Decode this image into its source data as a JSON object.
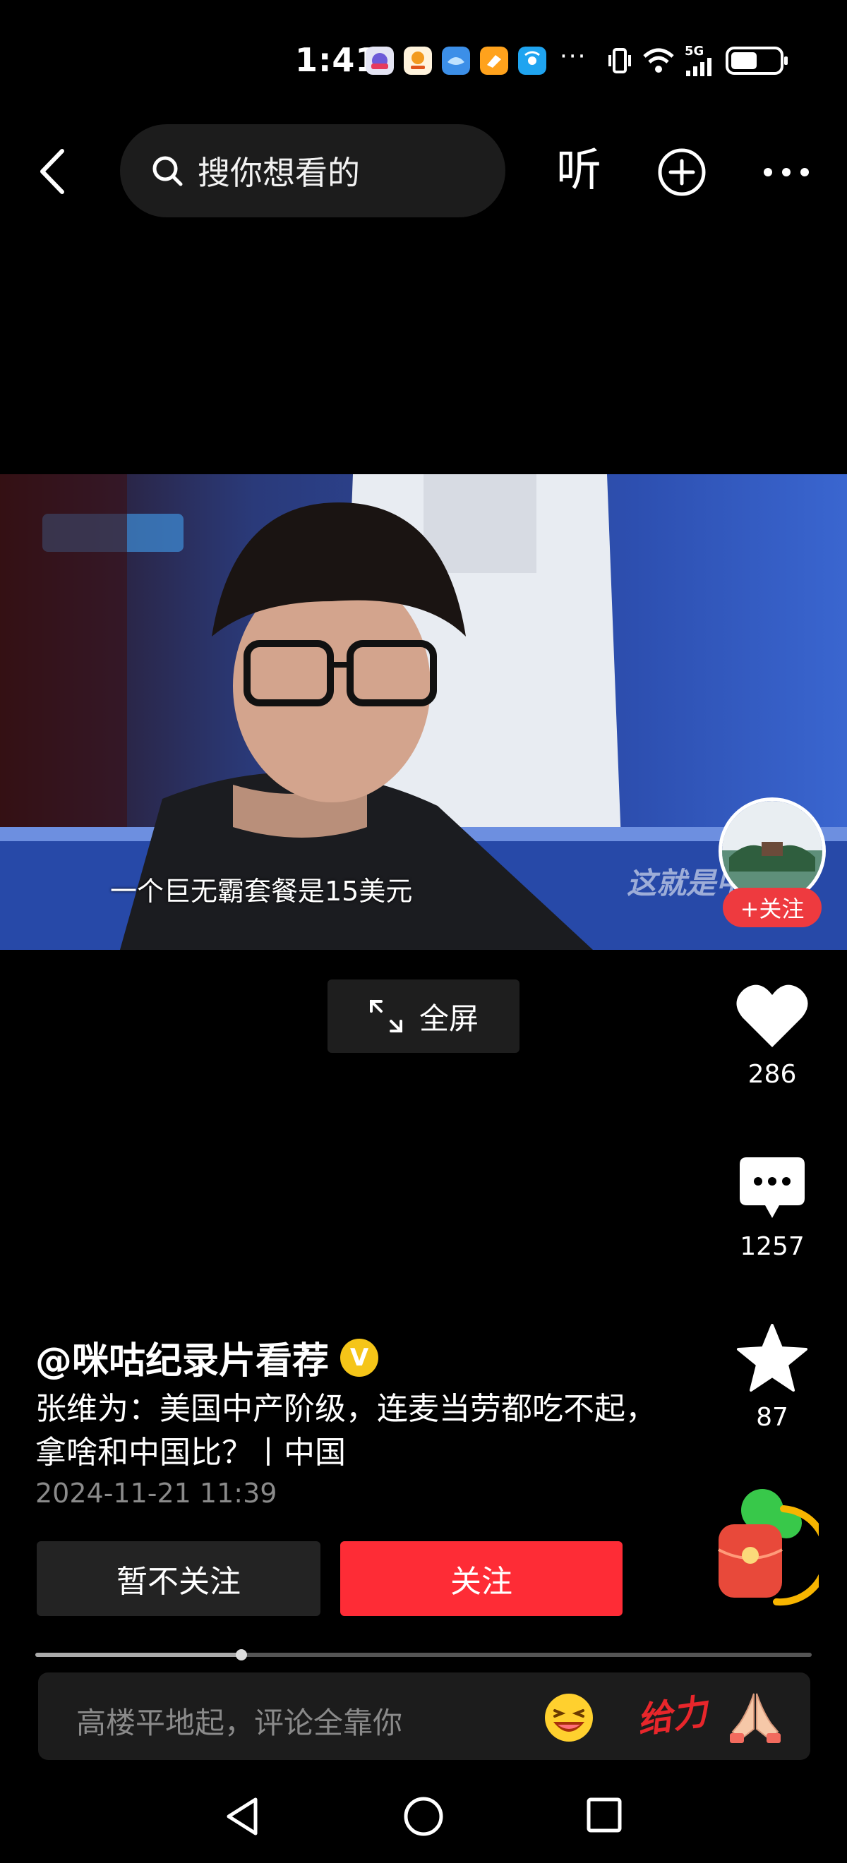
{
  "status_bar": {
    "time": "1:41",
    "more": "···",
    "network": "5G",
    "battery_level": 0.55,
    "icons": [
      "app-icon",
      "app-icon",
      "app-icon",
      "app-icon",
      "app-icon",
      "vibrate-icon",
      "wifi-icon",
      "signal-icon",
      "battery-icon"
    ]
  },
  "top_bar": {
    "search_placeholder": "搜你想看的",
    "listen_label": "听",
    "icons": [
      "back-icon",
      "search-icon",
      "add-icon",
      "more-icon"
    ]
  },
  "video": {
    "subtitle": "一个巨无霸套餐是15美元",
    "watermark": "这就是中",
    "follow_chip": "+关注",
    "fullscreen_label": "全屏"
  },
  "actions": {
    "likes": "286",
    "comments": "1257",
    "favorites": "87"
  },
  "post": {
    "author": "@咪咕纪录片看荐",
    "verified_mark": "V",
    "caption": "张维为：美国中产阶级，连麦当劳都吃不起，拿啥和中国比？丨中国",
    "time": "2024-11-21 11:39"
  },
  "buttons": {
    "dismiss": "暂不关注",
    "follow": "关注"
  },
  "progress": 0.265,
  "comment_bar": {
    "placeholder": "高楼平地起，评论全靠你",
    "sticker_text": "给力"
  },
  "colors": {
    "accent_red": "#fe2c36",
    "verified_yellow": "#f5c518",
    "background": "#000000"
  }
}
